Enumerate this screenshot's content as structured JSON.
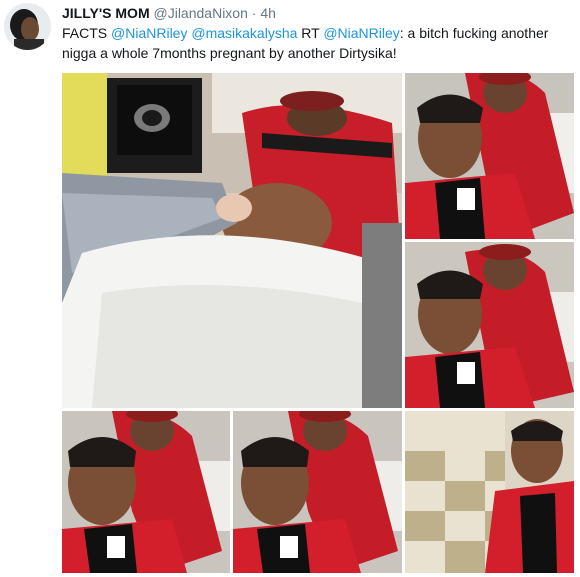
{
  "tweet": {
    "display_name": "JILLY'S MOM",
    "handle": "@JilandaNixon",
    "separator": "·",
    "time": "4h",
    "text_parts": [
      {
        "text": "FACTS ",
        "mention": false
      },
      {
        "text": "@NiaNRiley",
        "mention": true
      },
      {
        "text": " ",
        "mention": false
      },
      {
        "text": "@masikakalysha",
        "mention": true
      },
      {
        "text": " RT ",
        "mention": false
      },
      {
        "text": "@NiaNRiley",
        "mention": true
      },
      {
        "text": ": a bitch fucking another nigga a whole 7months pregnant by another Dirtysika!",
        "mention": false
      }
    ]
  },
  "colors": {
    "mention": "#1b95e0",
    "name": "#14171a",
    "meta": "#657786",
    "jacket_red": "#d31f2c"
  },
  "media": {
    "photos": [
      {
        "id": "ultrasound-photo",
        "kind": "ultrasound"
      },
      {
        "id": "selfie-1",
        "kind": "selfie"
      },
      {
        "id": "selfie-2",
        "kind": "selfie"
      },
      {
        "id": "selfie-3",
        "kind": "selfie"
      },
      {
        "id": "selfie-4",
        "kind": "selfie"
      },
      {
        "id": "selfie-5",
        "kind": "selfie-wide"
      }
    ]
  }
}
